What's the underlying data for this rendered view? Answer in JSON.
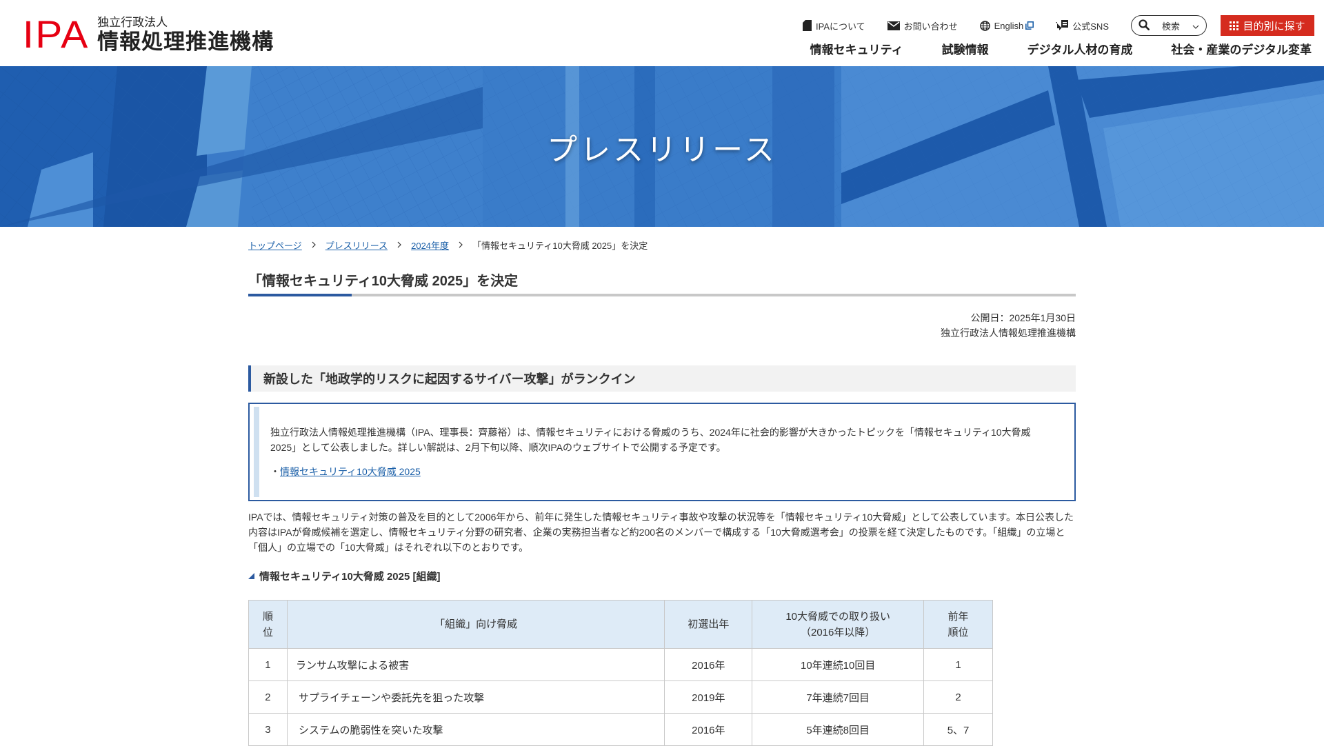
{
  "header": {
    "logo_mark": "IPA",
    "logo_sub": "独立行政法人",
    "logo_main": "情報処理推進機構",
    "util_nav": [
      {
        "label": "IPAについて",
        "icon": "document-icon"
      },
      {
        "label": "お問い合わせ",
        "icon": "mail-icon"
      },
      {
        "label": "English",
        "icon": "globe-icon",
        "external": true
      },
      {
        "label": "公式SNS",
        "icon": "chat-icon"
      }
    ],
    "search_label": "検索",
    "purpose_label": "目的別に探す",
    "main_nav": [
      "情報セキュリティ",
      "試験情報",
      "デジタル人材の育成",
      "社会・産業のデジタル変革"
    ]
  },
  "hero": {
    "title": "プレスリリース"
  },
  "breadcrumb": {
    "items": [
      "トップページ",
      "プレスリリース",
      "2024年度"
    ],
    "current": "「情報セキュリティ10大脅威 2025」を決定"
  },
  "article": {
    "title": "「情報セキュリティ10大脅威 2025」を決定",
    "published": "公開日：2025年1月30日",
    "publisher": "独立行政法人情報処理推進機構",
    "headline": "新設した「地政学的リスクに起因するサイバー攻撃」がランクイン",
    "summary": "独立行政法人情報処理推進機構（IPA、理事長：齊藤裕）は、情報セキュリティにおける脅威のうち、2024年に社会的影響が大きかったトピックを「情報セキュリティ10大脅威 2025」として公表しました。詳しい解説は、2月下旬以降、順次IPAのウェブサイトで公開する予定です。",
    "summary_link_prefix": "・",
    "summary_link": "情報セキュリティ10大脅威 2025",
    "intro": "IPAでは、情報セキュリティ対策の普及を目的として2006年から、前年に発生した情報セキュリティ事故や攻撃の状況等を「情報セキュリティ10大脅威」として公表しています。本日公表した内容はIPAが脅威候補を選定し、情報セキュリティ分野の研究者、企業の実務担当者など約200名のメンバーで構成する「10大脅威選考会」の投票を経て決定したものです。「組織」の立場と「個人」の立場での「10大脅威」はそれぞれ以下のとおりです。",
    "table_heading": "情報セキュリティ10大脅威 2025 [組織]"
  },
  "table": {
    "headers": {
      "rank_1": "順",
      "rank_2": "位",
      "threat": "「組織」向け脅威",
      "first_year": "初選出年",
      "handling_1": "10大脅威での取り扱い",
      "handling_2": "（2016年以降）",
      "prev_1": "前年",
      "prev_2": "順位"
    },
    "rows": [
      {
        "rank": "1",
        "threat": "ランサム攻撃による被害",
        "first_year": "2016年",
        "handling": "10年連続10回目",
        "prev": "1"
      },
      {
        "rank": "2",
        "threat": "サプライチェーンや委託先を狙った攻撃",
        "first_year": "2019年",
        "handling": "7年連続7回目",
        "prev": "2"
      },
      {
        "rank": "3",
        "threat": "システムの脆弱性を突いた攻撃",
        "first_year": "2016年",
        "handling": "5年連続8回目",
        "prev": "5、7"
      }
    ]
  },
  "colors": {
    "brand_red": "#e60012",
    "button_red": "#d52b1e",
    "accent_blue": "#2c5aa0",
    "link_blue": "#1a5fa8",
    "table_header_bg": "#deebf7"
  }
}
